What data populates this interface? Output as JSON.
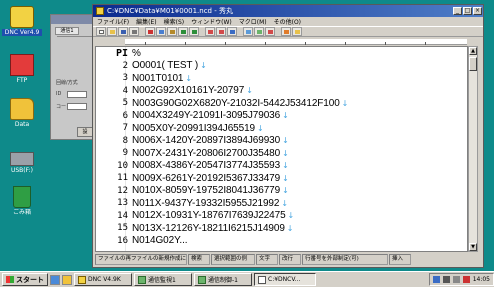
{
  "desktop": {
    "icons": [
      {
        "label": "DNC Ver4.9",
        "color": "#f2d243"
      },
      {
        "label": "FTP",
        "color": "#e33b3b"
      },
      {
        "label": "Data",
        "color": "#f0c23a"
      },
      {
        "label": "USB(F:)",
        "color": "#9aa0a8"
      },
      {
        "label": "ごみ箱",
        "color": "#2f9e44"
      }
    ]
  },
  "bg_dialog": {
    "tab_label": "通信1",
    "labels": [
      "回線/方式",
      "ID",
      "コード"
    ],
    "button_label": "設"
  },
  "editor": {
    "title": "C:¥DNC¥Data¥M01¥0001.ncd - 秀丸",
    "window_buttons": [
      "_",
      "□",
      "×"
    ],
    "menu": [
      "ファイル(F)",
      "編集(E)",
      "検索(S)",
      "ウィンドウ(W)",
      "マクロ(M)",
      "その他(O)"
    ],
    "toolbar_icons": [
      "new-icon",
      "open-icon",
      "save-icon",
      "print-icon",
      "cut-icon",
      "copy-icon",
      "paste-icon",
      "undo-icon",
      "redo-icon",
      "find-icon",
      "replace-icon",
      "grep-icon",
      "jump-icon",
      "bookmark-icon",
      "macro-icon",
      "config-icon",
      "help-icon"
    ],
    "pi_label": "PI",
    "lines": [
      {
        "num": "",
        "text": "%",
        "eol": ""
      },
      {
        "num": "2",
        "text": "O0001( TEST )",
        "eol": "↓"
      },
      {
        "num": "3",
        "text": "N001T0101",
        "eol": "↓"
      },
      {
        "num": "4",
        "text": "N002G92X10161Y-20797",
        "eol": "↓"
      },
      {
        "num": "5",
        "text": "N003G90G02X6820Y-21032I-5442J53412F100",
        "eol": "↓"
      },
      {
        "num": "6",
        "text": "N004X3249Y-21091I-3095J79036",
        "eol": "↓"
      },
      {
        "num": "7",
        "text": "N005X0Y-20991I394J65519",
        "eol": "↓"
      },
      {
        "num": "8",
        "text": "N006X-1420Y-20897I3894J69930",
        "eol": "↓"
      },
      {
        "num": "9",
        "text": "N007X-2431Y-20806I2700J35480",
        "eol": "↓"
      },
      {
        "num": "10",
        "text": "N008X-4386Y-20547I3774J35593",
        "eol": "↓"
      },
      {
        "num": "11",
        "text": "N009X-6261Y-20192I5367J33479",
        "eol": "↓"
      },
      {
        "num": "12",
        "text": "N010X-8059Y-19752I8041J36779",
        "eol": "↓"
      },
      {
        "num": "13",
        "text": "N011X-9437Y-19332I5955J21992",
        "eol": "↓"
      },
      {
        "num": "14",
        "text": "N012X-10931Y-18767I7639J22475",
        "eol": "↓"
      },
      {
        "num": "15",
        "text": "N013X-12126Y-18211I6215J14909",
        "eol": "↓"
      },
      {
        "num": "16",
        "text": "N014G02Y...",
        "eol": ""
      }
    ],
    "status": [
      "ファイルの再ファイルの新規作成に複数",
      "検索",
      "選択範囲の例",
      "文字",
      "改行",
      "行番号を外部制定(可)",
      "挿入"
    ]
  },
  "taskbar": {
    "start_label": "スタート",
    "tasks": [
      {
        "label": "DNC V4.9K",
        "active": false
      },
      {
        "label": "通信監視1",
        "active": false
      },
      {
        "label": "通信制御-1",
        "active": false
      },
      {
        "label": "C:¥DNCV...",
        "active": true
      }
    ],
    "clock": "14:05"
  }
}
